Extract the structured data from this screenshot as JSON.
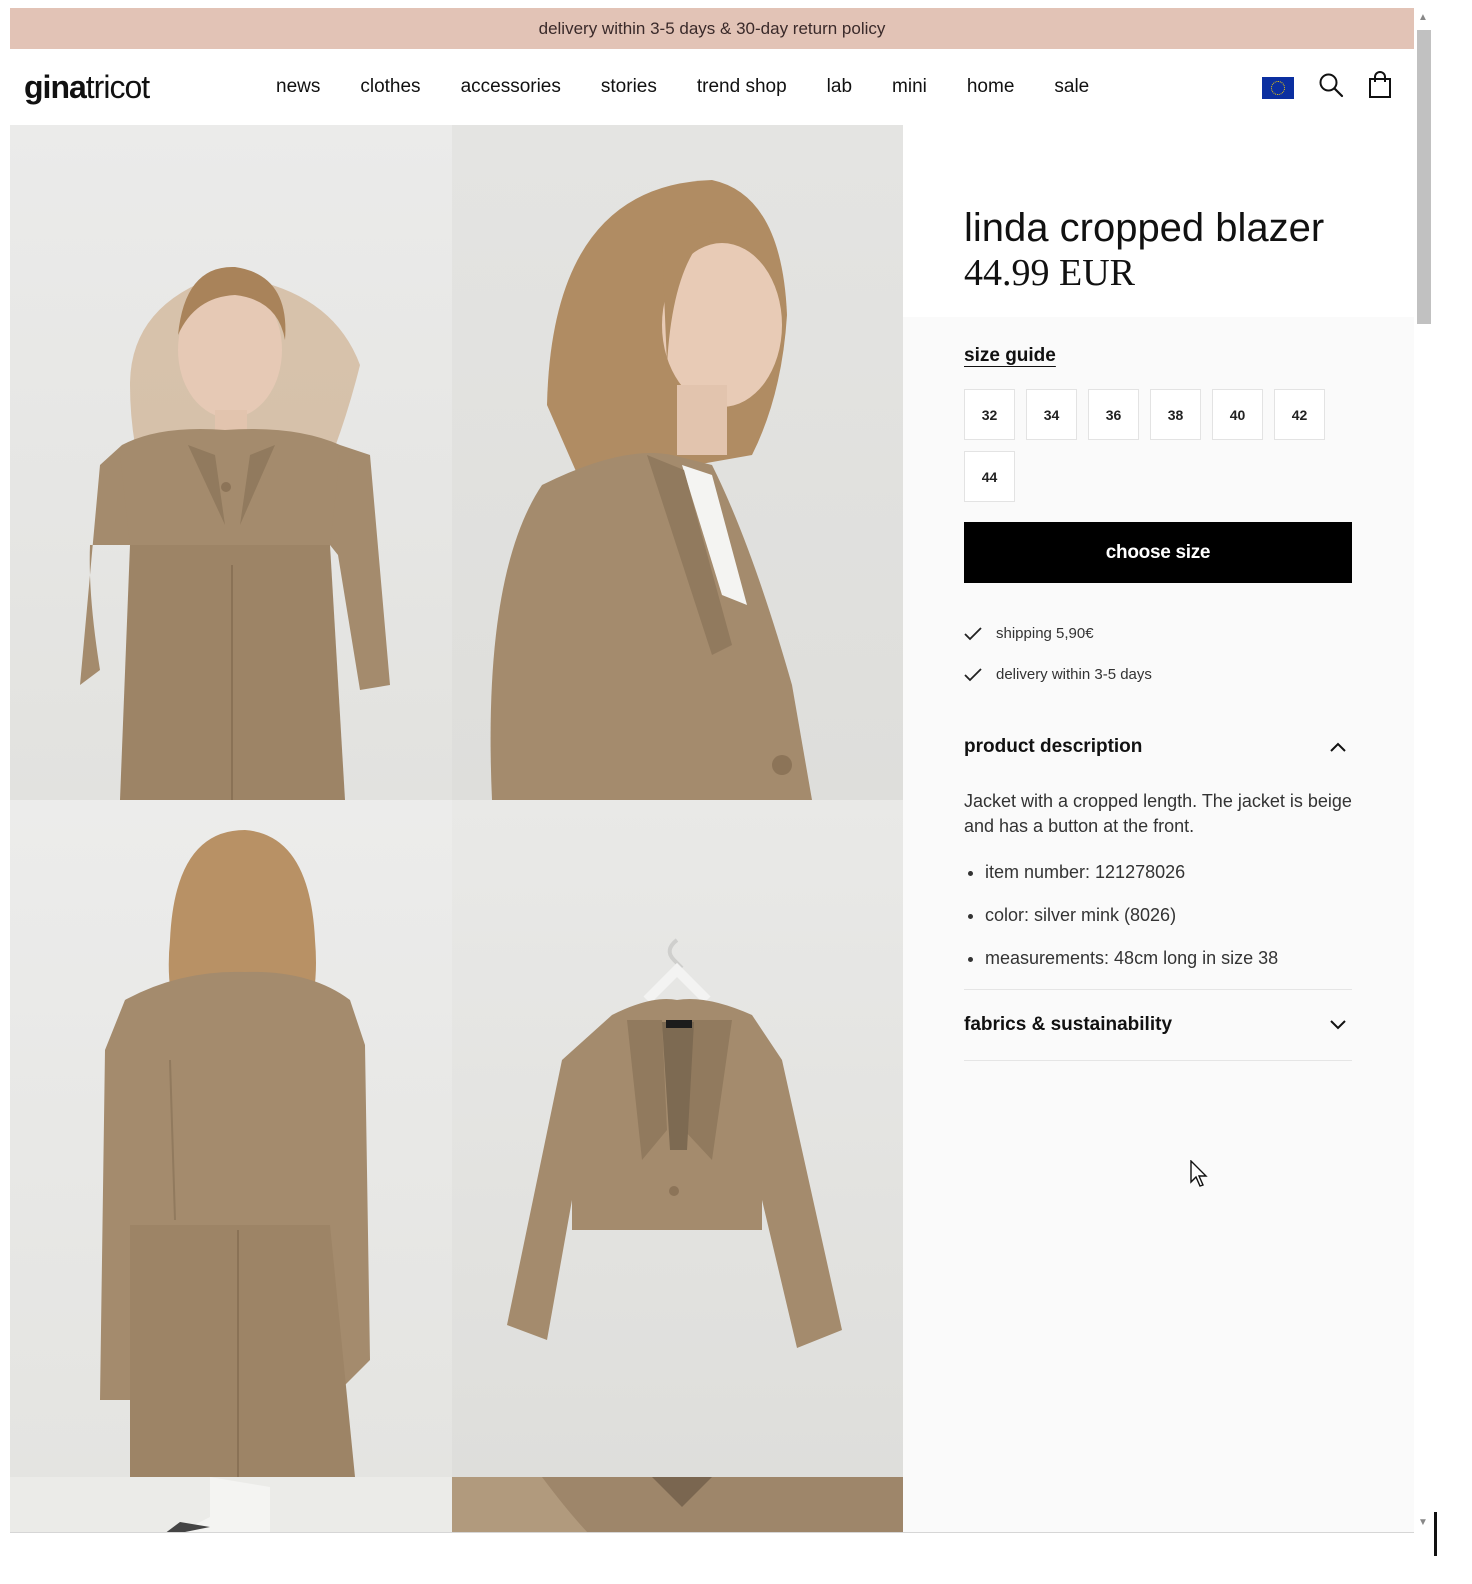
{
  "promo": {
    "text": "delivery within 3-5 days & 30-day return policy"
  },
  "header": {
    "logo_bold": "gina",
    "logo_light": "tricot",
    "nav": [
      "news",
      "clothes",
      "accessories",
      "stories",
      "trend shop",
      "lab",
      "mini",
      "home",
      "sale"
    ],
    "icons": [
      "eu-flag-icon",
      "search-icon",
      "shopping-bag-icon"
    ]
  },
  "product": {
    "title": "linda cropped blazer",
    "price": "44.99 EUR",
    "size_guide": "size guide",
    "sizes": [
      "32",
      "34",
      "36",
      "38",
      "40",
      "42",
      "44"
    ],
    "cta": "choose size",
    "usps": [
      "shipping 5,90€",
      "delivery within 3-5 days"
    ],
    "description": {
      "heading": "product description",
      "expanded": true,
      "text": "Jacket with a cropped length. The jacket is beige and has a button at the front.",
      "bullets": [
        "item number: 121278026",
        "color: silver mink (8026)",
        "measurements: 48cm long in size 38"
      ]
    },
    "fabrics": {
      "heading": "fabrics & sustainability",
      "expanded": false
    }
  },
  "colors": {
    "promo_bg": "#e2c3b6",
    "cta_bg": "#000000",
    "blazer": "#a48b6d",
    "flag": "#0b2fa0"
  }
}
